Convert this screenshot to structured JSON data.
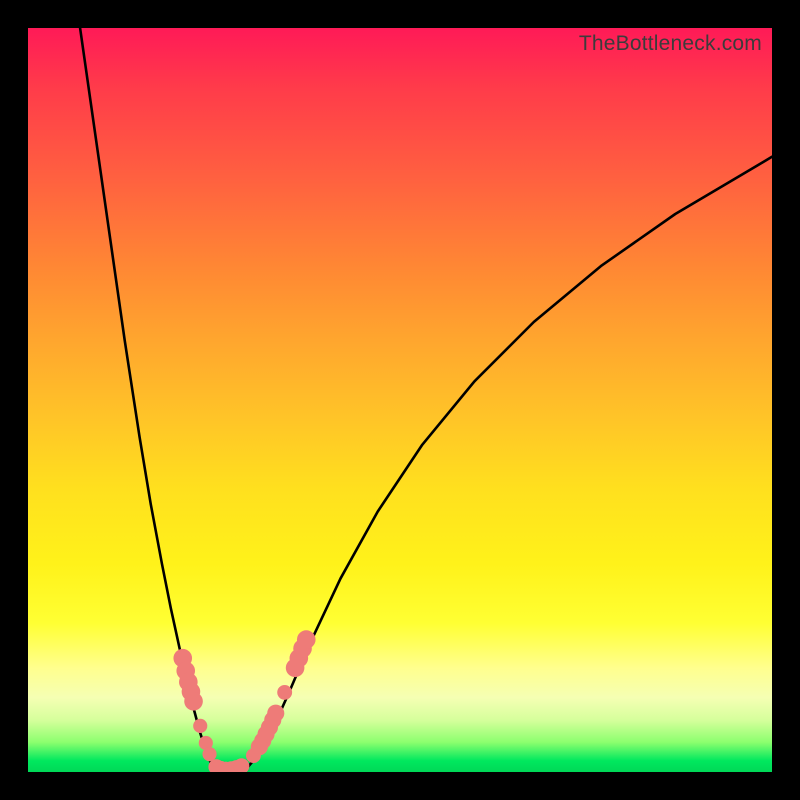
{
  "watermark": "TheBottleneck.com",
  "colors": {
    "frame": "#000000",
    "curve": "#000000",
    "marker_fill": "#ee7b78",
    "marker_stroke": "#c9504f"
  },
  "chart_data": {
    "type": "line",
    "title": "",
    "xlabel": "",
    "ylabel": "",
    "xlim": [
      0,
      100
    ],
    "ylim": [
      0,
      100
    ],
    "grid": false,
    "legend": false,
    "note": "no axis tick labels rendered; values are estimated from pixel positions",
    "series": [
      {
        "name": "left-branch",
        "x": [
          7,
          9,
          11,
          13,
          15,
          16.5,
          18,
          19.2,
          20.4,
          21.4,
          22.3,
          23.1,
          23.8,
          24.4,
          24.9
        ],
        "y": [
          100,
          86,
          72,
          58,
          45,
          36,
          28,
          22,
          16.5,
          12,
          8.4,
          5.4,
          3.2,
          1.6,
          0.6
        ]
      },
      {
        "name": "floor",
        "x": [
          24.9,
          25.6,
          26.4,
          27.3,
          28.3,
          29.5
        ],
        "y": [
          0.6,
          0.2,
          0.08,
          0.1,
          0.25,
          0.6
        ]
      },
      {
        "name": "right-branch",
        "x": [
          29.5,
          31,
          32.8,
          35,
          38,
          42,
          47,
          53,
          60,
          68,
          77,
          87,
          98,
          100
        ],
        "y": [
          0.6,
          2.4,
          5.6,
          10.5,
          17.5,
          26,
          35,
          44,
          52.5,
          60.5,
          68,
          75,
          81.5,
          82.7
        ]
      }
    ],
    "markers": [
      {
        "x": 20.8,
        "y": 15.3,
        "r": 1.25
      },
      {
        "x": 21.2,
        "y": 13.6,
        "r": 1.25
      },
      {
        "x": 21.55,
        "y": 12.1,
        "r": 1.25
      },
      {
        "x": 21.9,
        "y": 10.8,
        "r": 1.25
      },
      {
        "x": 22.25,
        "y": 9.5,
        "r": 1.25
      },
      {
        "x": 23.15,
        "y": 6.2,
        "r": 0.95
      },
      {
        "x": 23.9,
        "y": 3.9,
        "r": 0.95
      },
      {
        "x": 24.4,
        "y": 2.4,
        "r": 0.95
      },
      {
        "x": 25.3,
        "y": 0.68,
        "r": 1.05
      },
      {
        "x": 25.9,
        "y": 0.45,
        "r": 1.05
      },
      {
        "x": 26.6,
        "y": 0.35,
        "r": 1.05
      },
      {
        "x": 27.3,
        "y": 0.4,
        "r": 1.05
      },
      {
        "x": 28.0,
        "y": 0.55,
        "r": 1.05
      },
      {
        "x": 28.7,
        "y": 0.8,
        "r": 1.05
      },
      {
        "x": 30.3,
        "y": 2.2,
        "r": 1.0
      },
      {
        "x": 31.1,
        "y": 3.4,
        "r": 1.15
      },
      {
        "x": 31.55,
        "y": 4.2,
        "r": 1.15
      },
      {
        "x": 32.0,
        "y": 5.1,
        "r": 1.15
      },
      {
        "x": 32.45,
        "y": 6.0,
        "r": 1.15
      },
      {
        "x": 32.9,
        "y": 7.0,
        "r": 1.15
      },
      {
        "x": 33.3,
        "y": 7.9,
        "r": 1.15
      },
      {
        "x": 34.5,
        "y": 10.7,
        "r": 1.0
      },
      {
        "x": 35.9,
        "y": 14.0,
        "r": 1.25
      },
      {
        "x": 36.4,
        "y": 15.3,
        "r": 1.25
      },
      {
        "x": 36.9,
        "y": 16.6,
        "r": 1.25
      },
      {
        "x": 37.4,
        "y": 17.8,
        "r": 1.25
      }
    ]
  }
}
